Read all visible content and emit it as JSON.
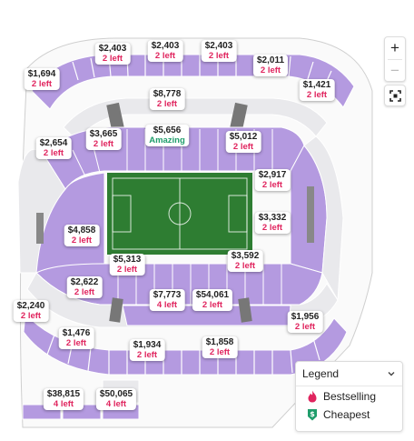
{
  "legend": {
    "title": "Legend",
    "items": [
      {
        "label": "Bestselling",
        "icon": "flame-icon",
        "color": "#e0245e"
      },
      {
        "label": "Cheapest",
        "icon": "dollar-tag-icon",
        "color": "#1f9d6b"
      }
    ]
  },
  "zoom": {
    "in_label": "+",
    "out_label": "−"
  },
  "prices": [
    {
      "price": "$2,403",
      "left": "2 left"
    },
    {
      "price": "$2,403",
      "left": "2 left"
    },
    {
      "price": "$2,403",
      "left": "2 left"
    },
    {
      "price": "$2,011",
      "left": "2 left"
    },
    {
      "price": "$1,694",
      "left": "2 left"
    },
    {
      "price": "$1,421",
      "left": "2 left"
    },
    {
      "price": "$8,778",
      "left": "2 left"
    },
    {
      "price": "$3,665",
      "left": "2 left"
    },
    {
      "price": "$5,656",
      "left": "Amazing"
    },
    {
      "price": "$5,012",
      "left": "2 left"
    },
    {
      "price": "$2,654",
      "left": "2 left"
    },
    {
      "price": "$2,917",
      "left": "2 left"
    },
    {
      "price": "$3,332",
      "left": "2 left"
    },
    {
      "price": "$4,858",
      "left": "2 left"
    },
    {
      "price": "$5,313",
      "left": "2 left"
    },
    {
      "price": "$3,592",
      "left": "2 left"
    },
    {
      "price": "$2,622",
      "left": "2 left"
    },
    {
      "price": "$7,773",
      "left": "4 left"
    },
    {
      "price": "$54,061",
      "left": "2 left"
    },
    {
      "price": "$2,240",
      "left": "2 left"
    },
    {
      "price": "$1,956",
      "left": "2 left"
    },
    {
      "price": "$1,476",
      "left": "2 left"
    },
    {
      "price": "$1,934",
      "left": "2 left"
    },
    {
      "price": "$1,858",
      "left": "2 left"
    },
    {
      "price": "$38,815",
      "left": "4 left"
    },
    {
      "price": "$50,065",
      "left": "4 left"
    }
  ],
  "colors": {
    "available": "#b49ae0",
    "unavailable": "#e9e9ec",
    "field": "#2e7d32",
    "accent": "#e0245e",
    "good": "#1f9d6b"
  }
}
